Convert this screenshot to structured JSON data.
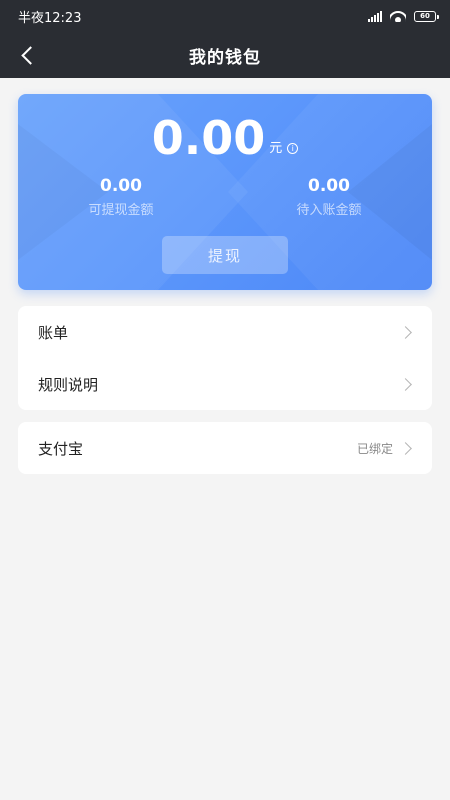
{
  "status_bar": {
    "time": "半夜12:23",
    "battery": "60"
  },
  "nav": {
    "title": "我的钱包"
  },
  "wallet": {
    "total": "0.00",
    "unit": "元",
    "info_glyph": "i",
    "withdrawable_value": "0.00",
    "withdrawable_label": "可提现金额",
    "pending_value": "0.00",
    "pending_label": "待入账金额",
    "withdraw_button": "提现"
  },
  "menu": {
    "bill": "账单",
    "rules": "规则说明",
    "alipay": "支付宝",
    "alipay_status": "已绑定"
  },
  "colors": {
    "accent": "#5b96fb",
    "topbar": "#2a2d33",
    "background": "#f4f4f4"
  },
  "icons": [
    "back-arrow-icon",
    "signal-icon",
    "wifi-icon",
    "battery-icon",
    "info-icon",
    "chevron-right-icon"
  ]
}
